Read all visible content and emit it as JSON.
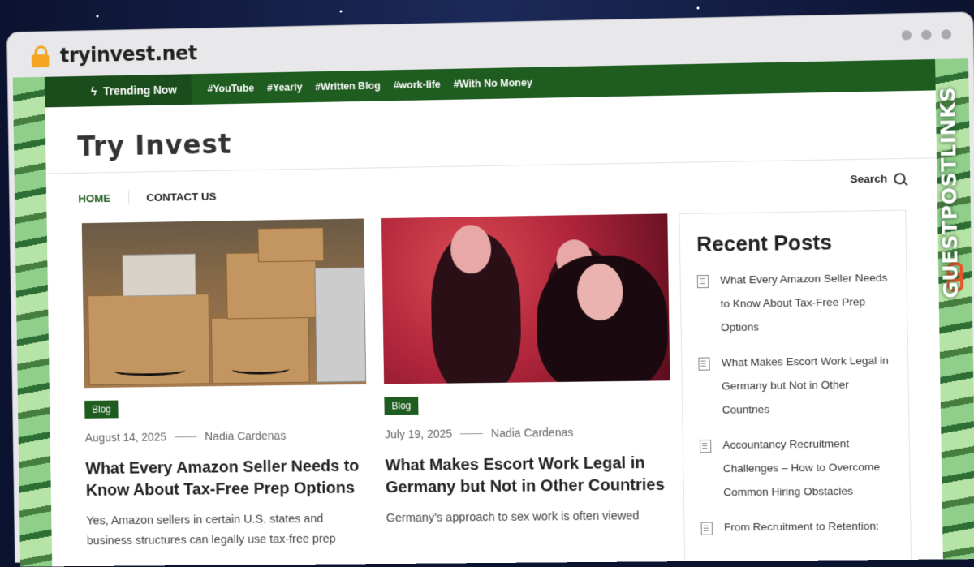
{
  "browser": {
    "url": "tryinvest.net"
  },
  "watermark": "GUESTPOSTLINKS",
  "topbar": {
    "trending_label": "Trending Now",
    "tags": [
      "#YouTube",
      "#Yearly",
      "#Written Blog",
      "#work-life",
      "#With No Money"
    ]
  },
  "header": {
    "logo": "Try Invest"
  },
  "nav": {
    "items": [
      "HOME",
      "CONTACT US"
    ],
    "active": "HOME",
    "search_label": "Search"
  },
  "posts": [
    {
      "category": "Blog",
      "date": "August 14, 2025",
      "author": "Nadia Cardenas",
      "title": "What Every Amazon Seller Needs to Know About Tax-Free Prep Options",
      "excerpt": "Yes, Amazon sellers in certain U.S. states and business structures can legally use tax-free prep"
    },
    {
      "category": "Blog",
      "date": "July 19, 2025",
      "author": "Nadia Cardenas",
      "title": "What Makes Escort Work Legal in Germany but Not in Other Countries",
      "excerpt": "Germany’s approach to sex work is often viewed"
    }
  ],
  "sidebar": {
    "title": "Recent Posts",
    "items": [
      "What Every Amazon Seller Needs to Know About Tax-Free Prep Options",
      "What Makes Escort Work Legal in Germany but Not in Other Countries",
      "Accountancy Recruitment Challenges – How to Overcome Common Hiring Obstacles",
      "From Recruitment to Retention:"
    ]
  }
}
